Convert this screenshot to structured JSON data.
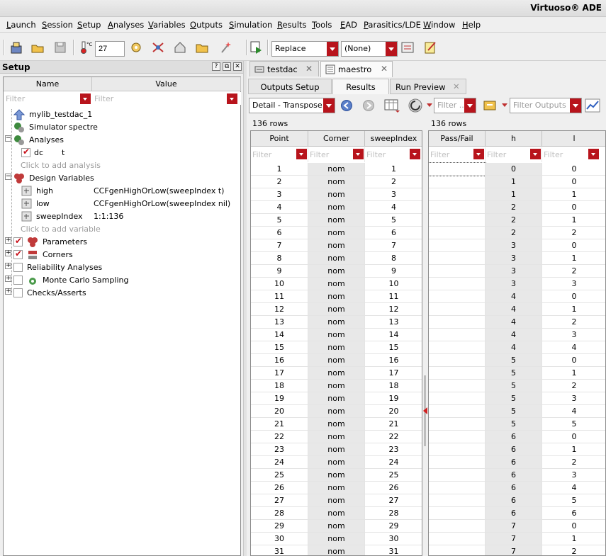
{
  "window": {
    "title": "Virtuoso® ADE"
  },
  "menu": [
    "Launch",
    "Session",
    "Setup",
    "Analyses",
    "Variables",
    "Outputs",
    "Simulation",
    "Results",
    "Tools",
    "EAD",
    "Parasitics/LDE",
    "Window",
    "Help"
  ],
  "toolbar": {
    "temperature": "27",
    "temp_unit": "°C",
    "run_mode": "Replace",
    "history": "(None)"
  },
  "setup": {
    "title": "Setup",
    "header_buttons": [
      "?",
      "⧉",
      "✕"
    ],
    "columns": {
      "name": "Name",
      "value": "Value"
    },
    "filter_placeholder": "Filter",
    "test_name": "mylib_testdac_1",
    "simulator_label": "Simulator",
    "simulator_value": "spectre",
    "analyses_label": "Analyses",
    "analysis_name": "dc",
    "analysis_value": "t",
    "add_analysis": "Click to add analysis",
    "design_vars_label": "Design Variables",
    "variables": [
      {
        "name": "high",
        "value": "CCFgenHighOrLow(sweepIndex t)"
      },
      {
        "name": "low",
        "value": "CCFgenHighOrLow(sweepIndex nil)"
      },
      {
        "name": "sweepIndex",
        "value": "1:1:136"
      }
    ],
    "add_variable": "Click to add variable",
    "parameters": "Parameters",
    "corners": "Corners",
    "reliability": "Reliability Analyses",
    "monte_carlo": "Monte Carlo Sampling",
    "checks": "Checks/Asserts"
  },
  "tabs": {
    "doc_tabs": [
      "testdac",
      "maestro"
    ],
    "close_glyph": "✕",
    "sub_tabs": [
      "Outputs Setup",
      "Results",
      "Run Preview"
    ]
  },
  "results": {
    "view_mode": "Detail - Transpose",
    "filter_small": "Filter ...",
    "filter_outputs": "Filter Outputs",
    "rows_label_left": "136 rows",
    "rows_label_right": "136 rows",
    "left_columns": [
      "Point",
      "Corner",
      "sweepIndex"
    ],
    "right_columns": [
      "Pass/Fail",
      "h",
      "l"
    ],
    "filter_placeholder": "Filter",
    "rows": [
      [
        "1",
        "nom",
        "1",
        "0",
        "0"
      ],
      [
        "2",
        "nom",
        "2",
        "1",
        "0"
      ],
      [
        "3",
        "nom",
        "3",
        "1",
        "1"
      ],
      [
        "4",
        "nom",
        "4",
        "2",
        "0"
      ],
      [
        "5",
        "nom",
        "5",
        "2",
        "1"
      ],
      [
        "6",
        "nom",
        "6",
        "2",
        "2"
      ],
      [
        "7",
        "nom",
        "7",
        "3",
        "0"
      ],
      [
        "8",
        "nom",
        "8",
        "3",
        "1"
      ],
      [
        "9",
        "nom",
        "9",
        "3",
        "2"
      ],
      [
        "10",
        "nom",
        "10",
        "3",
        "3"
      ],
      [
        "11",
        "nom",
        "11",
        "4",
        "0"
      ],
      [
        "12",
        "nom",
        "12",
        "4",
        "1"
      ],
      [
        "13",
        "nom",
        "13",
        "4",
        "2"
      ],
      [
        "14",
        "nom",
        "14",
        "4",
        "3"
      ],
      [
        "15",
        "nom",
        "15",
        "4",
        "4"
      ],
      [
        "16",
        "nom",
        "16",
        "5",
        "0"
      ],
      [
        "17",
        "nom",
        "17",
        "5",
        "1"
      ],
      [
        "18",
        "nom",
        "18",
        "5",
        "2"
      ],
      [
        "19",
        "nom",
        "19",
        "5",
        "3"
      ],
      [
        "20",
        "nom",
        "20",
        "5",
        "4"
      ],
      [
        "21",
        "nom",
        "21",
        "5",
        "5"
      ],
      [
        "22",
        "nom",
        "22",
        "6",
        "0"
      ],
      [
        "23",
        "nom",
        "23",
        "6",
        "1"
      ],
      [
        "24",
        "nom",
        "24",
        "6",
        "2"
      ],
      [
        "25",
        "nom",
        "25",
        "6",
        "3"
      ],
      [
        "26",
        "nom",
        "26",
        "6",
        "4"
      ],
      [
        "27",
        "nom",
        "27",
        "6",
        "5"
      ],
      [
        "28",
        "nom",
        "28",
        "6",
        "6"
      ],
      [
        "29",
        "nom",
        "29",
        "7",
        "0"
      ],
      [
        "30",
        "nom",
        "30",
        "7",
        "1"
      ],
      [
        "31",
        "nom",
        "31",
        "7",
        "2"
      ]
    ]
  }
}
